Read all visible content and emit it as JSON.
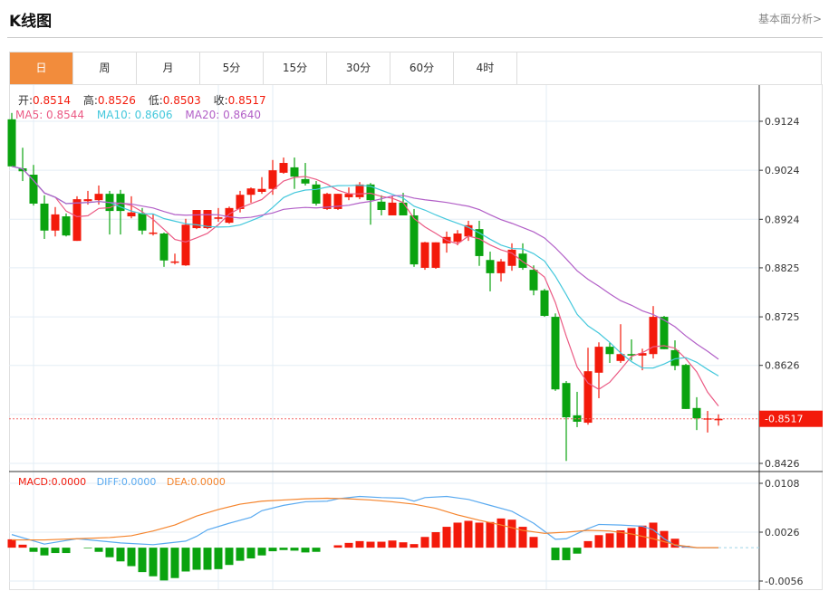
{
  "header": {
    "title": "K线图",
    "link": "基本面分析>"
  },
  "tabs": [
    {
      "label": "日",
      "active": true
    },
    {
      "label": "周"
    },
    {
      "label": "月"
    },
    {
      "label": "5分"
    },
    {
      "label": "15分"
    },
    {
      "label": "30分"
    },
    {
      "label": "60分"
    },
    {
      "label": "4时"
    }
  ],
  "ohlc_legend": {
    "open_label": "开:",
    "open": "0.8514",
    "high_label": "高:",
    "high": "0.8526",
    "low_label": "低:",
    "low": "0.8503",
    "close_label": "收:",
    "close": "0.8517"
  },
  "ma_legend": {
    "ma5": "MA5: 0.8544",
    "ma10": "MA10: 0.8606",
    "ma20": "MA20: 0.8640"
  },
  "macd_legend": {
    "macd": "MACD:0.0000",
    "diff": "DIFF:0.0000",
    "dea": "DEA:0.0000"
  },
  "colors": {
    "up": "#f31a0b",
    "down": "#0aa30f",
    "ma5": "#eb5a84",
    "ma10": "#44c8dc",
    "ma20": "#b25fc7",
    "diff": "#5aaaf0",
    "dea": "#f5842c",
    "active_tab": "#f28c3c"
  },
  "chart_data": [
    {
      "type": "candlestick",
      "price_ticks": [
        "0.9124",
        "0.9024",
        "0.8924",
        "0.8825",
        "0.8725",
        "0.8626",
        "0.8426"
      ],
      "ylim": [
        0.8426,
        0.9124
      ],
      "current_price": "0.8517",
      "ohlc": [
        [
          0.9128,
          0.9141,
          0.9032,
          0.9032
        ],
        [
          0.9028,
          0.907,
          0.9002,
          0.9022
        ],
        [
          0.9015,
          0.9035,
          0.8952,
          0.8956
        ],
        [
          0.8956,
          0.8973,
          0.8884,
          0.8901
        ],
        [
          0.8901,
          0.8949,
          0.8889,
          0.8934
        ],
        [
          0.893,
          0.8936,
          0.8889,
          0.8891
        ],
        [
          0.888,
          0.8971,
          0.888,
          0.8965
        ],
        [
          0.8961,
          0.8982,
          0.8954,
          0.8965
        ],
        [
          0.8963,
          0.8993,
          0.8954,
          0.8976
        ],
        [
          0.8976,
          0.8982,
          0.8893,
          0.8941
        ],
        [
          0.8976,
          0.8984,
          0.8893,
          0.8941
        ],
        [
          0.893,
          0.8971,
          0.8926,
          0.8938
        ],
        [
          0.8936,
          0.8947,
          0.8893,
          0.8901
        ],
        [
          0.8895,
          0.8934,
          0.8891,
          0.8897
        ],
        [
          0.8895,
          0.8897,
          0.8827,
          0.884
        ],
        [
          0.8836,
          0.8854,
          0.8832,
          0.8838
        ],
        [
          0.883,
          0.8925,
          0.8829,
          0.8913
        ],
        [
          0.8906,
          0.8943,
          0.8904,
          0.8943
        ],
        [
          0.8906,
          0.8943,
          0.8904,
          0.8943
        ],
        [
          0.8925,
          0.8947,
          0.8919,
          0.8928
        ],
        [
          0.8917,
          0.895,
          0.8915,
          0.8947
        ],
        [
          0.8945,
          0.8982,
          0.8938,
          0.8974
        ],
        [
          0.8974,
          0.8989,
          0.8958,
          0.8987
        ],
        [
          0.898,
          0.901,
          0.8976,
          0.8986
        ],
        [
          0.8986,
          0.9045,
          0.8974,
          0.9024
        ],
        [
          0.9019,
          0.905,
          0.9017,
          0.9039
        ],
        [
          0.903,
          0.905,
          0.8986,
          0.9011
        ],
        [
          0.9006,
          0.9039,
          0.8993,
          0.8997
        ],
        [
          0.8995,
          0.9002,
          0.8952,
          0.8956
        ],
        [
          0.8945,
          0.8978,
          0.8943,
          0.8976
        ],
        [
          0.8945,
          0.8976,
          0.8943,
          0.8976
        ],
        [
          0.8969,
          0.8989,
          0.8963,
          0.8976
        ],
        [
          0.8969,
          0.9,
          0.8965,
          0.8995
        ],
        [
          0.8995,
          0.8998,
          0.8913,
          0.8963
        ],
        [
          0.896,
          0.8973,
          0.8932,
          0.8943
        ],
        [
          0.8932,
          0.8971,
          0.8932,
          0.8958
        ],
        [
          0.8958,
          0.8978,
          0.8932,
          0.8932
        ],
        [
          0.8932,
          0.8945,
          0.8827,
          0.8832
        ],
        [
          0.8825,
          0.8878,
          0.8821,
          0.8877
        ],
        [
          0.8825,
          0.8877,
          0.8823,
          0.8877
        ],
        [
          0.8875,
          0.8899,
          0.8856,
          0.8888
        ],
        [
          0.8878,
          0.8902,
          0.8871,
          0.8895
        ],
        [
          0.8889,
          0.8921,
          0.888,
          0.8912
        ],
        [
          0.8904,
          0.8921,
          0.8829,
          0.8849
        ],
        [
          0.8841,
          0.8858,
          0.8777,
          0.8814
        ],
        [
          0.8814,
          0.8843,
          0.8797,
          0.8838
        ],
        [
          0.8829,
          0.8875,
          0.8819,
          0.8862
        ],
        [
          0.8854,
          0.8875,
          0.8821,
          0.8825
        ],
        [
          0.8821,
          0.883,
          0.8769,
          0.8779
        ],
        [
          0.8779,
          0.8782,
          0.8725,
          0.8727
        ],
        [
          0.8725,
          0.8732,
          0.8574,
          0.8577
        ],
        [
          0.859,
          0.8594,
          0.8431,
          0.852
        ],
        [
          0.8524,
          0.8572,
          0.85,
          0.8511
        ],
        [
          0.8509,
          0.8662,
          0.8505,
          0.8614
        ],
        [
          0.8611,
          0.8673,
          0.8559,
          0.8664
        ],
        [
          0.8664,
          0.8673,
          0.8631,
          0.8649
        ],
        [
          0.8635,
          0.871,
          0.8631,
          0.8649
        ],
        [
          0.8649,
          0.8679,
          0.8636,
          0.8646
        ],
        [
          0.8646,
          0.866,
          0.8616,
          0.8651
        ],
        [
          0.8649,
          0.8747,
          0.864,
          0.8725
        ],
        [
          0.8725,
          0.8727,
          0.8659,
          0.8659
        ],
        [
          0.8657,
          0.8677,
          0.8616,
          0.8625
        ],
        [
          0.8627,
          0.8629,
          0.8537,
          0.8537
        ],
        [
          0.8539,
          0.8561,
          0.8494,
          0.8518
        ],
        [
          0.8516,
          0.8533,
          0.8489,
          0.8518
        ],
        [
          0.8514,
          0.8526,
          0.8503,
          0.8517
        ]
      ]
    },
    {
      "type": "bar+line",
      "ticks": [
        "0.0108",
        "0.0026",
        "-0.0056"
      ],
      "ylim": [
        -0.0056,
        0.0108
      ],
      "macd": [
        0.0014,
        0.0005,
        -0.0007,
        -0.0013,
        -0.0009,
        -0.0009,
        0,
        -0.0001,
        -0.0007,
        -0.0016,
        -0.0023,
        -0.0031,
        -0.0041,
        -0.0048,
        -0.0055,
        -0.0051,
        -0.004,
        -0.0037,
        -0.0037,
        -0.0036,
        -0.0029,
        -0.0022,
        -0.0018,
        -0.0013,
        -0.0006,
        -0.0004,
        -0.0005,
        -0.0008,
        -0.0007,
        0,
        0.0004,
        0.0008,
        0.0011,
        0.001,
        0.001,
        0.0012,
        0.0009,
        0.0006,
        0.0018,
        0.0026,
        0.0035,
        0.0042,
        0.0045,
        0.0042,
        0.0043,
        0.0049,
        0.0047,
        0.0035,
        0.0018,
        0,
        -0.0021,
        -0.0021,
        -0.001,
        0.0011,
        0.0021,
        0.0024,
        0.0029,
        0.0033,
        0.0037,
        0.0042,
        0.0028,
        0.0015,
        0.0003,
        0,
        0,
        0
      ],
      "diff": [
        [
          0,
          0.0022
        ],
        [
          3,
          0.0006
        ],
        [
          6,
          0.0015
        ],
        [
          10,
          0.0008
        ],
        [
          13,
          0.0005
        ],
        [
          14,
          0.0007
        ],
        [
          16,
          0.0011
        ],
        [
          17,
          0.0019
        ],
        [
          18,
          0.003
        ],
        [
          20,
          0.0041
        ],
        [
          22,
          0.0051
        ],
        [
          23,
          0.0062
        ],
        [
          25,
          0.0071
        ],
        [
          27,
          0.0077
        ],
        [
          29,
          0.0078
        ],
        [
          30,
          0.0082
        ],
        [
          32,
          0.0086
        ],
        [
          34,
          0.0084
        ],
        [
          36,
          0.0083
        ],
        [
          37,
          0.0078
        ],
        [
          38,
          0.0084
        ],
        [
          40,
          0.0086
        ],
        [
          42,
          0.0081
        ],
        [
          44,
          0.0071
        ],
        [
          46,
          0.0061
        ],
        [
          48,
          0.0041
        ],
        [
          50,
          0.0014
        ],
        [
          51,
          0.0015
        ],
        [
          53,
          0.0032
        ],
        [
          54,
          0.0039
        ],
        [
          56,
          0.0038
        ],
        [
          58,
          0.0036
        ],
        [
          59,
          0.003
        ],
        [
          60,
          0.0015
        ],
        [
          61,
          0.0004
        ],
        [
          62,
          0.0001
        ],
        [
          63,
          0
        ],
        [
          65,
          0
        ]
      ],
      "dea": [
        [
          0,
          0.0013
        ],
        [
          3,
          0.0013
        ],
        [
          6,
          0.0015
        ],
        [
          9,
          0.0017
        ],
        [
          11,
          0.002
        ],
        [
          13,
          0.0028
        ],
        [
          15,
          0.0038
        ],
        [
          17,
          0.0053
        ],
        [
          19,
          0.0064
        ],
        [
          21,
          0.0073
        ],
        [
          23,
          0.0078
        ],
        [
          25,
          0.008
        ],
        [
          27,
          0.0082
        ],
        [
          29,
          0.0083
        ],
        [
          31,
          0.0082
        ],
        [
          33,
          0.008
        ],
        [
          35,
          0.0077
        ],
        [
          37,
          0.0073
        ],
        [
          39,
          0.0066
        ],
        [
          41,
          0.0055
        ],
        [
          43,
          0.0046
        ],
        [
          45,
          0.0038
        ],
        [
          47,
          0.0029
        ],
        [
          49,
          0.0024
        ],
        [
          51,
          0.0026
        ],
        [
          53,
          0.0029
        ],
        [
          55,
          0.0028
        ],
        [
          57,
          0.0023
        ],
        [
          59,
          0.0015
        ],
        [
          61,
          0.0005
        ],
        [
          63,
          0
        ],
        [
          65,
          0
        ]
      ]
    }
  ]
}
